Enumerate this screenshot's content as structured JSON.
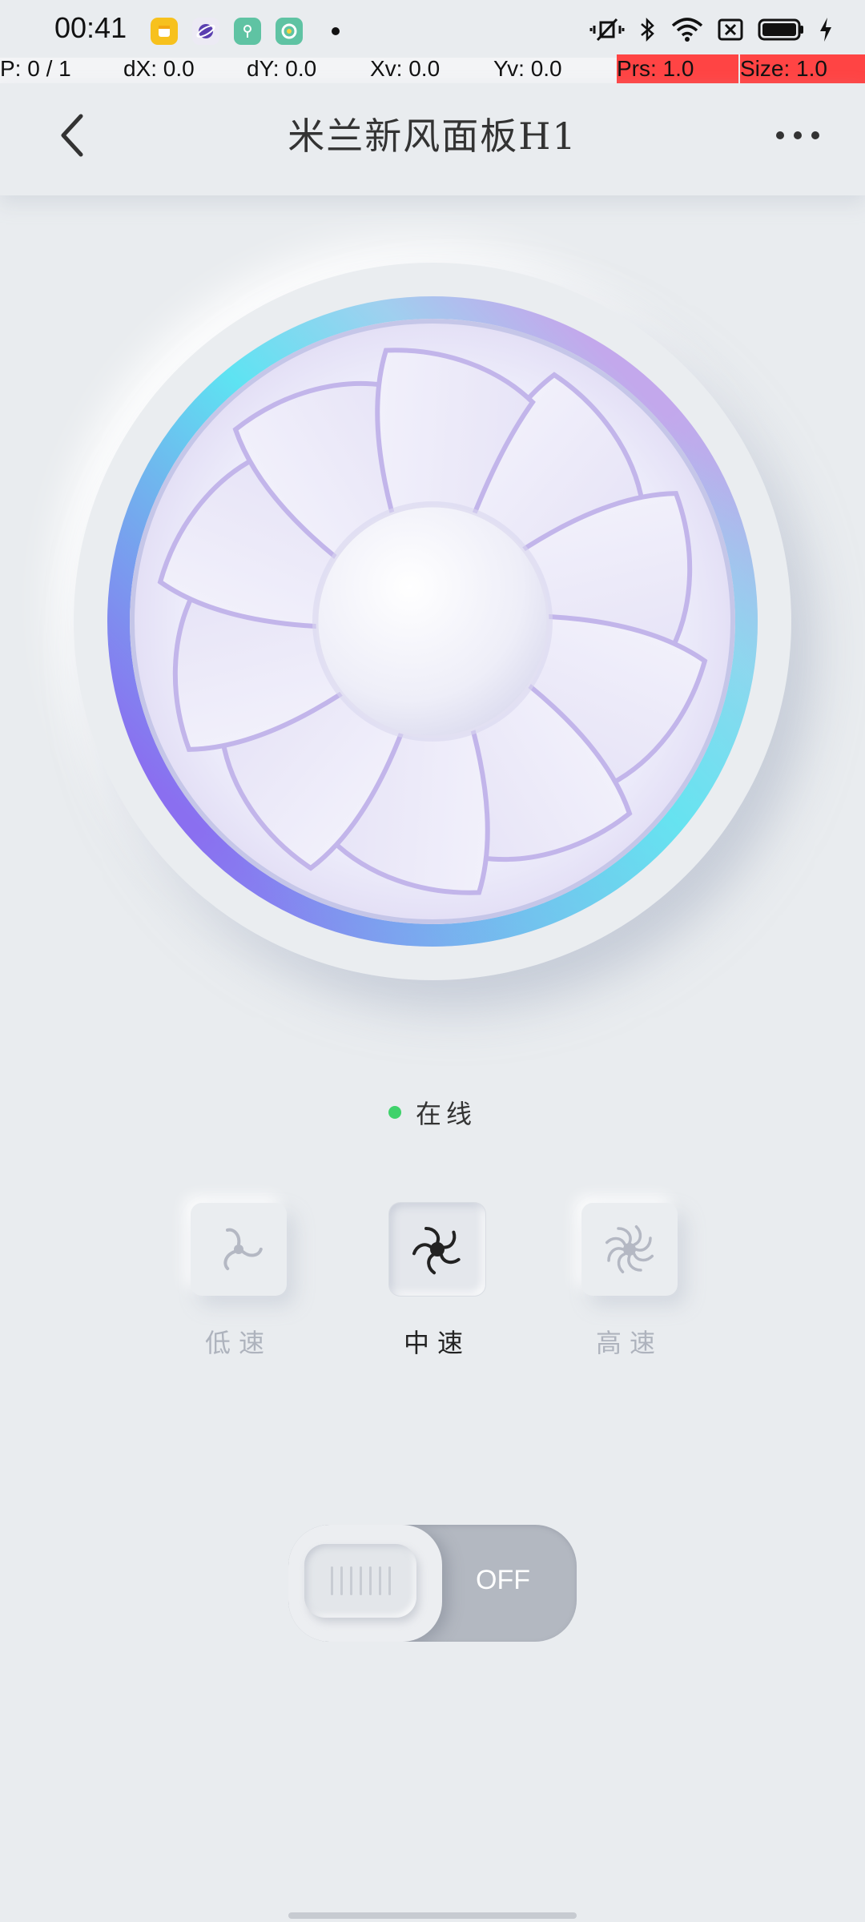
{
  "status_bar": {
    "time": "00:41",
    "app_icons": [
      "notes-app-icon",
      "planet-app-icon",
      "key-app-icon",
      "ring-app-icon"
    ],
    "right_icons": [
      "vibrate-mute-icon",
      "bluetooth-icon",
      "wifi-icon",
      "sim-x-icon",
      "battery-icon",
      "charging-icon"
    ]
  },
  "debug": {
    "pointer": "P: 0 / 1",
    "dx": "dX: 0.0",
    "dy": "dY: 0.0",
    "xv": "Xv: 0.0",
    "yv": "Yv: 0.0",
    "prs": "Prs: 1.0",
    "size": "Size: 1.0"
  },
  "header": {
    "title": "米兰新风面板H1",
    "back_icon": "chevron-left-icon",
    "more_icon": "more-dots-icon"
  },
  "status": {
    "text": "在线",
    "color": "#3fd26b"
  },
  "speeds": [
    {
      "label": "低速",
      "icon": "fan-low-icon",
      "active": false
    },
    {
      "label": "中速",
      "icon": "fan-medium-icon",
      "active": true
    },
    {
      "label": "高速",
      "icon": "fan-high-icon",
      "active": false
    }
  ],
  "power": {
    "label": "OFF",
    "state": "off"
  },
  "colors": {
    "background": "#e9ecef",
    "ring_cyan": "#5ee3f2",
    "ring_purple": "#8a6ff0",
    "ring_lavender": "#c3a8ec",
    "online_green": "#3fd26b"
  }
}
